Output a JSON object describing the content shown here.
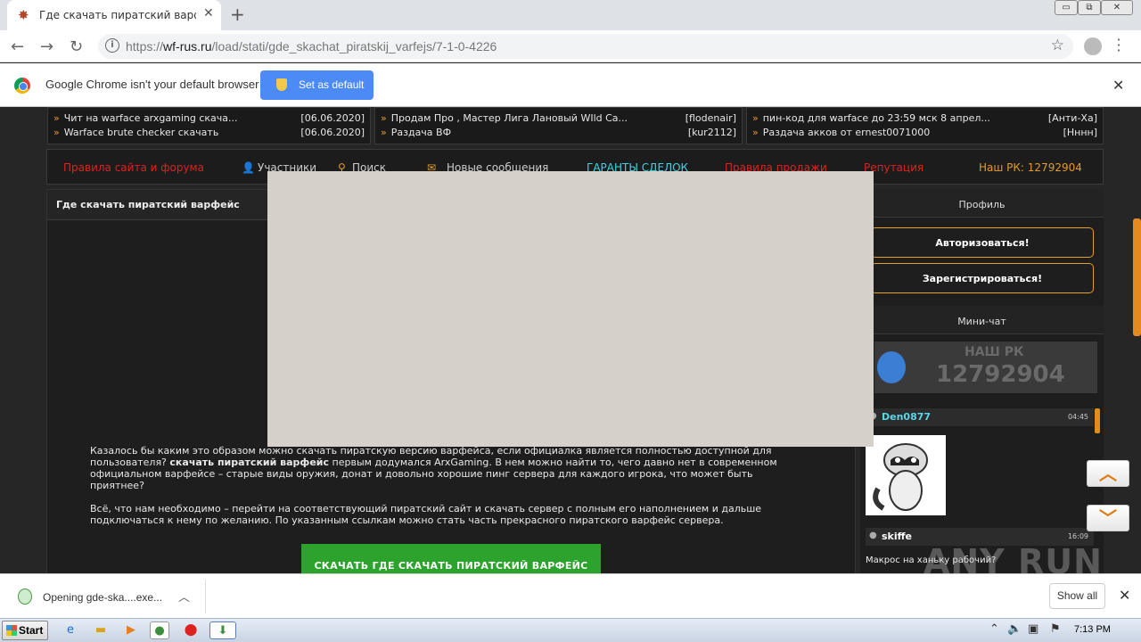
{
  "browser": {
    "tab_title": "Где скачать пиратский варфейс",
    "url_prefix": "https://",
    "url_domain": "wf-rus.ru",
    "url_path": "/load/stati/gde_skachat_piratskij_varfejs/7-1-0-4226",
    "infobar_message": "Google Chrome isn't your default browser",
    "set_default_label": "Set as default"
  },
  "topics": {
    "col1": [
      {
        "title": "Чит на warface arxgaming скача...",
        "meta": "[06.06.2020]"
      },
      {
        "title": "Warface brute checker скачать",
        "meta": "[06.06.2020]"
      }
    ],
    "col2": [
      {
        "title": "Продам Про , Мастер Лига Лановый WIld Ca...",
        "meta": "[flodenair]"
      },
      {
        "title": "Раздача ВФ",
        "meta": "[kur2112]"
      }
    ],
    "col3": [
      {
        "title": "пин-код для warface до 23:59 мск 8 апрел...",
        "meta": "[Анти-Ха]"
      },
      {
        "title": "Раздача акков от ernest0071000",
        "meta": "[Нннн]"
      }
    ]
  },
  "nav": {
    "rules": "Правила сайта и форума",
    "members": "Участники",
    "search": "Поиск",
    "new_messages": "Новые сообщения",
    "guarantors": "ГАРАНТЫ СДЕЛОК",
    "sale_rules": "Правила продажи",
    "reputation": "Репутация",
    "rk": "Наш РК: 12792904"
  },
  "content": {
    "heading": "Где скачать пиратский варфейс",
    "p1_a": "Казалось бы каким это образом можно скачать пиратскую версию варфейса, если официалка является полностью доступной для пользователя? ",
    "p1_bold": "скачать пиратский варфейс",
    "p1_b": " первым додумался ArxGaming. В нем можно найти то, чего давно нет в современном официальном варфейсе – старые виды оружия, донат и довольно хорошие пинг сервера для каждого игрока, что может быть приятнее?",
    "p2": "Всё, что нам необходимо – перейти на соответствующий пиратский сайт и скачать сервер с полным его наполнением и дальше подключаться к нему по желанию. По указанным ссылкам можно стать часть прекрасного пиратского варфейс сервера.",
    "download_label": "СКАЧАТЬ ГДЕ СКАЧАТЬ ПИРАТСКИЙ ВАРФЕЙС"
  },
  "sidebar": {
    "profile_title": "Профиль",
    "login_label": "Авторизоваться!",
    "register_label": "Зарегистрироваться!",
    "minichat_title": "Мини-чат",
    "rk_label": "НАШ РК",
    "rk_number": "12792904",
    "chat": [
      {
        "user": "Den0877",
        "time": "04:45",
        "color": "#59d6e8"
      },
      {
        "user": "skiffe",
        "time": "16:09",
        "color": "#ffffff",
        "message": "Макрос на ханьку рабочий?"
      }
    ]
  },
  "watermark": "ANY RUN",
  "downloads": {
    "file_label": "Opening gde-ska....exe...",
    "show_all": "Show all"
  },
  "taskbar": {
    "start": "Start",
    "clock": "7:13 PM"
  }
}
